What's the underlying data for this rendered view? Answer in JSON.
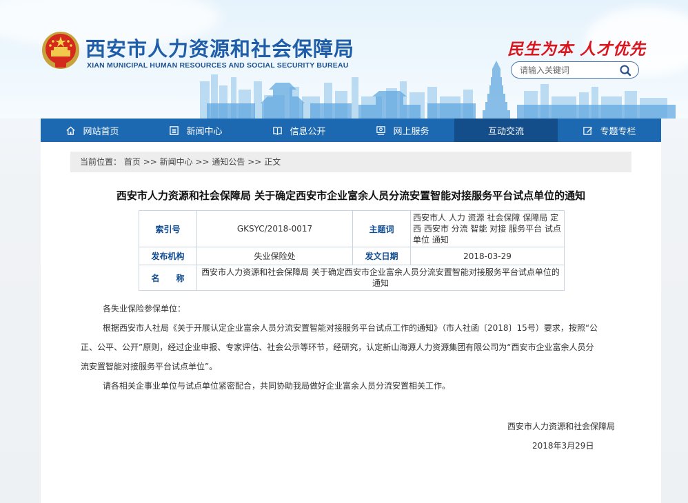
{
  "header": {
    "title": "西安市人力资源和社会保障局",
    "subtitle": "XIAN MUNICIPAL HUMAN RESOURCES AND SOCIAL SECURITY BUREAU",
    "slogan": "民生为本 人才优先",
    "search_placeholder": "请输入关键词"
  },
  "nav": {
    "items": [
      {
        "label": "网站首页",
        "icon": "home-icon"
      },
      {
        "label": "新闻中心",
        "icon": "news-icon"
      },
      {
        "label": "信息公开",
        "icon": "book-icon"
      },
      {
        "label": "网上服务",
        "icon": "service-icon"
      },
      {
        "label": "互动交流",
        "icon": "",
        "active": true
      },
      {
        "label": "专题专栏",
        "icon": "edit-icon"
      }
    ]
  },
  "breadcrumb": {
    "prefix": "当前位置：",
    "items": [
      "首页",
      "新闻中心",
      "通知公告",
      "正文"
    ],
    "separator": ">>"
  },
  "article": {
    "title": "西安市人力资源和社会保障局 关于确定西安市企业富余人员分流安置智能对接服务平台试点单位的通知",
    "meta": {
      "index_label": "索引号",
      "index_value": "GKSYC/2018-0017",
      "subject_label": "主题词",
      "subject_value": "西安市人 人力 资源 社会保障 保障局 定西 西安市 分流 智能 对接 服务平台 试点 单位 通知",
      "issuer_label": "发布机构",
      "issuer_value": "失业保险处",
      "date_label": "发文日期",
      "date_value": "2018-03-29",
      "name_label": "名　　称",
      "name_value": "西安市人力资源和社会保障局 关于确定西安市企业富余人员分流安置智能对接服务平台试点单位的通知"
    },
    "greeting": "各失业保险参保单位：",
    "paragraph1_line1": "根据西安市人社局《关于开展认定企业富余人员分流安置智能对接服务平台试点工作的通知》（市人社函〔2018〕15号）要求，按照“公",
    "paragraph1_line2": "正、公平、公开”原则，经过企业申报、专家评估、社会公示等环节，经研究，认定新山海源人力资源集团有限公司为“西安市企业富余人员分",
    "paragraph1_line3": "流安置智能对接服务平台试点单位”。",
    "paragraph2": "请各相关企事业单位与试点单位紧密配合，共同协助我局做好企业富余人员分流安置相关工作。",
    "signature_org": "西安市人力资源和社会保障局",
    "signature_date": "2018年3月29日"
  },
  "colors": {
    "nav_bg": "#1d69b1",
    "nav_active": "#134d8a",
    "title_blue": "#1f5da8",
    "slogan_red": "#d9161e",
    "label_blue": "#0f4c92"
  }
}
